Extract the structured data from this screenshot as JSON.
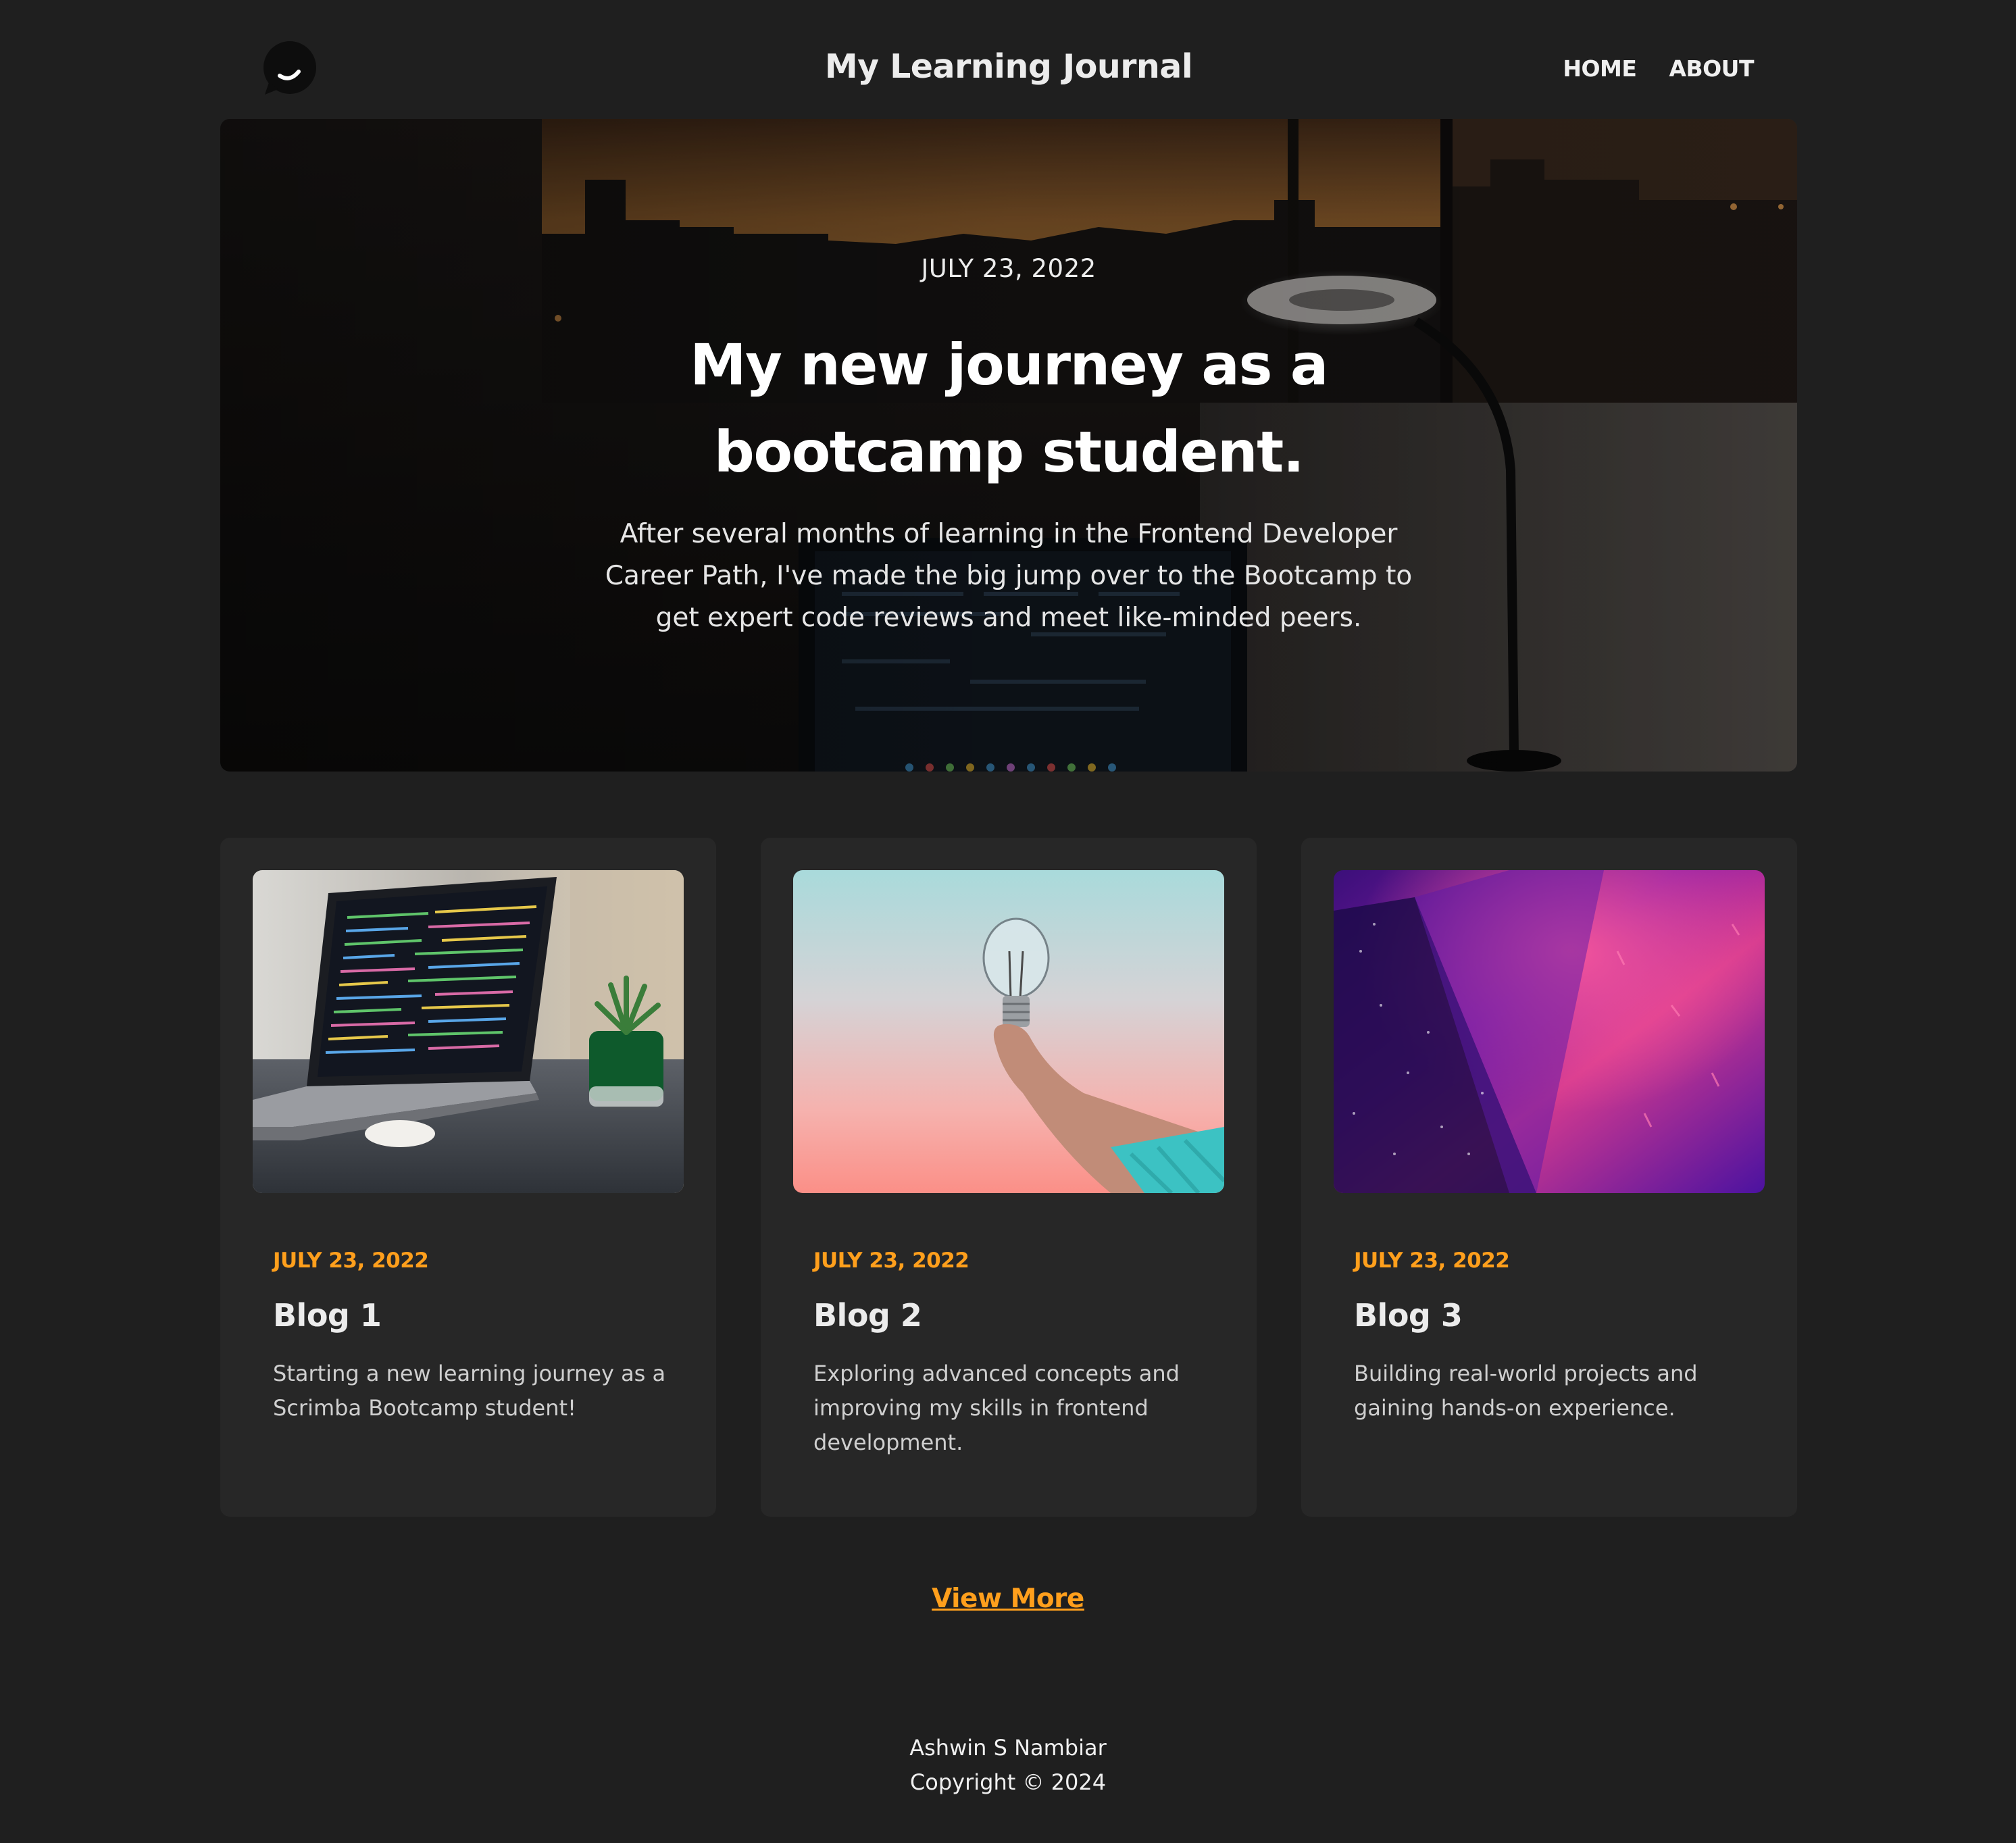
{
  "header": {
    "title": "My Learning Journal",
    "nav": [
      {
        "label": "HOME"
      },
      {
        "label": "ABOUT"
      }
    ]
  },
  "hero": {
    "date": "JULY 23, 2022",
    "title_line1": "My new journey as a",
    "title_line2": "bootcamp student.",
    "text": "After several months of learning in the Frontend Developer Career Path, I've made the big jump over to the Bootcamp to get expert code reviews and meet like-minded peers."
  },
  "posts": [
    {
      "date": "JULY 23, 2022",
      "title": "Blog 1",
      "text": "Starting a new learning journey as a Scrimba Bootcamp student!"
    },
    {
      "date": "JULY 23, 2022",
      "title": "Blog 2",
      "text": "Exploring advanced concepts and improving my skills in frontend development."
    },
    {
      "date": "JULY 23, 2022",
      "title": "Blog 3",
      "text": "Building real-world projects and gaining hands-on experience."
    }
  ],
  "view_more": {
    "label": "View More"
  },
  "footer": {
    "author": "Ashwin S Nambiar",
    "copyright": "Copyright © 2024"
  },
  "colors": {
    "background": "#1f1f1f",
    "card_background": "#272727",
    "accent": "#ff9f1c",
    "text": "#ececec"
  },
  "icons": {
    "logo": "logo-icon"
  }
}
